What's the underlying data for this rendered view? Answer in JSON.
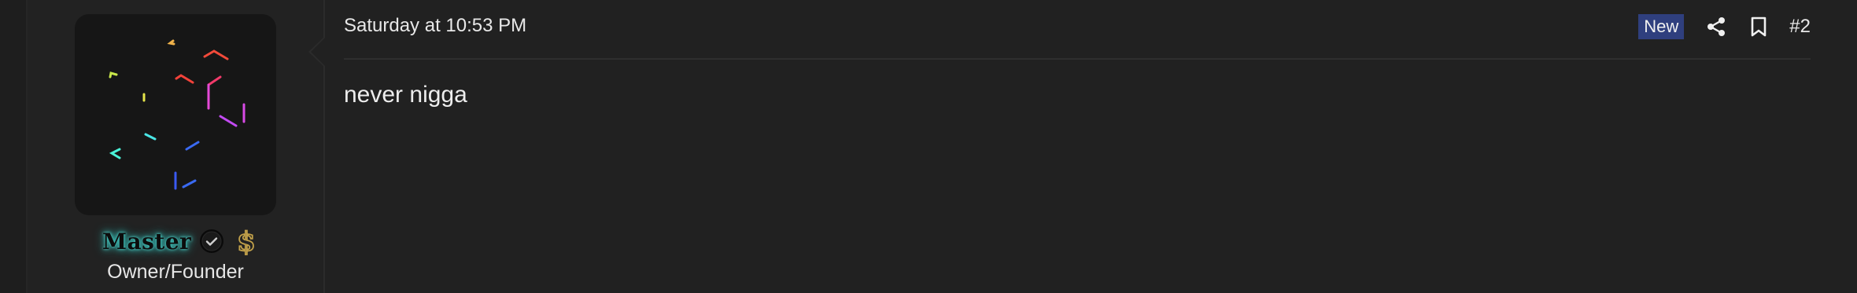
{
  "post": {
    "date": "Saturday at 10:53 PM",
    "badge": "New",
    "number": "#2",
    "body": "never nigga"
  },
  "user": {
    "name": "Master",
    "title": "Owner/Founder",
    "avatar": "glitch-art-avatar",
    "badges": [
      "verified-check-icon",
      "dollar-sign-icon"
    ]
  },
  "icons": {
    "share": "share-icon",
    "bookmark": "bookmark-icon"
  },
  "colors": {
    "background": "#212121",
    "badge_bg": "#2f3f7e",
    "username_glow": "#3ec9c2",
    "dollar_gold": "#c2a14a"
  }
}
